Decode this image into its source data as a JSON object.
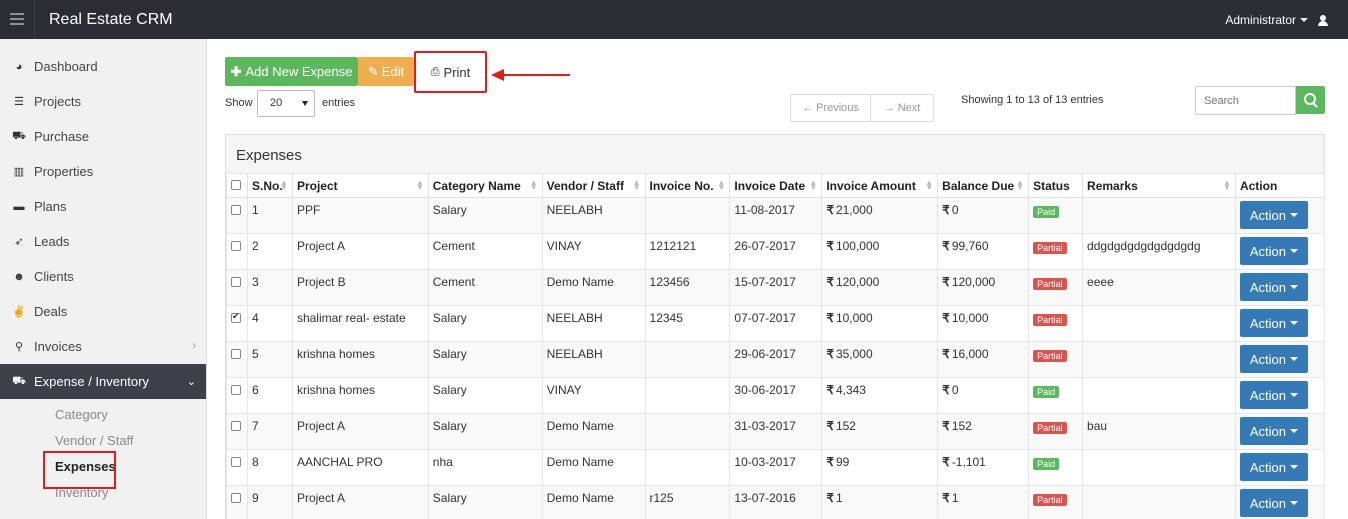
{
  "header": {
    "app_title": "Real Estate CRM",
    "user_label": "Administrator"
  },
  "sidebar": {
    "items": [
      {
        "label": "Dashboard",
        "icon": "dashboard-icon"
      },
      {
        "label": "Projects",
        "icon": "list-icon"
      },
      {
        "label": "Purchase",
        "icon": "cart-icon"
      },
      {
        "label": "Properties",
        "icon": "building-icon"
      },
      {
        "label": "Plans",
        "icon": "briefcase-icon"
      },
      {
        "label": "Leads",
        "icon": "rocket-icon"
      },
      {
        "label": "Clients",
        "icon": "users-icon"
      },
      {
        "label": "Deals",
        "icon": "thumbs-up-icon"
      },
      {
        "label": "Invoices",
        "icon": "pin-icon"
      },
      {
        "label": "Expense / Inventory",
        "icon": "cart-icon"
      }
    ],
    "subitems": [
      "Category",
      "Vendor / Staff",
      "Expenses",
      "Inventory"
    ]
  },
  "toolbar": {
    "add_label": "Add New Expense",
    "edit_label": "Edit",
    "print_label": "Print"
  },
  "list_controls": {
    "show_label": "Show",
    "entries_value": "20",
    "entries_label": "entries",
    "prev_label": "← Previous",
    "next_label": "→ Next",
    "showing_text": "Showing 1 to 13 of 13 entries",
    "search_placeholder": "Search"
  },
  "table": {
    "title": "Expenses",
    "columns": [
      "S.No.",
      "Project",
      "Category Name",
      "Vendor / Staff",
      "Invoice No.",
      "Invoice Date",
      "Invoice Amount",
      "Balance Due",
      "Status",
      "Remarks",
      "Action"
    ],
    "currency_symbol": "₹",
    "action_label": "Action",
    "rows": [
      {
        "checked": false,
        "sno": "1",
        "project": "PPF",
        "category": "Salary",
        "vendor": "NEELABH",
        "invoice_no": "",
        "invoice_date": "11-08-2017",
        "amount": "21,000",
        "balance": "0",
        "status": "Paid",
        "remarks": ""
      },
      {
        "checked": false,
        "sno": "2",
        "project": "Project A",
        "category": "Cement",
        "vendor": "VINAY",
        "invoice_no": "1212121",
        "invoice_date": "26-07-2017",
        "amount": "100,000",
        "balance": "99,760",
        "status": "Partial",
        "remarks": "ddgdgdgdgdgdgdgdg"
      },
      {
        "checked": false,
        "sno": "3",
        "project": "Project B",
        "category": "Cement",
        "vendor": "Demo Name",
        "invoice_no": "123456",
        "invoice_date": "15-07-2017",
        "amount": "120,000",
        "balance": "120,000",
        "status": "Partial",
        "remarks": "eeee"
      },
      {
        "checked": true,
        "sno": "4",
        "project": "shalimar real- estate",
        "category": "Salary",
        "vendor": "NEELABH",
        "invoice_no": "12345",
        "invoice_date": "07-07-2017",
        "amount": "10,000",
        "balance": "10,000",
        "status": "Partial",
        "remarks": ""
      },
      {
        "checked": false,
        "sno": "5",
        "project": "krishna homes",
        "category": "Salary",
        "vendor": "NEELABH",
        "invoice_no": "",
        "invoice_date": "29-06-2017",
        "amount": "35,000",
        "balance": "16,000",
        "status": "Partial",
        "remarks": ""
      },
      {
        "checked": false,
        "sno": "6",
        "project": "krishna homes",
        "category": "Salary",
        "vendor": "VINAY",
        "invoice_no": "",
        "invoice_date": "30-06-2017",
        "amount": "4,343",
        "balance": "0",
        "status": "Paid",
        "remarks": ""
      },
      {
        "checked": false,
        "sno": "7",
        "project": "Project A",
        "category": "Salary",
        "vendor": "Demo Name",
        "invoice_no": "",
        "invoice_date": "31-03-2017",
        "amount": "152",
        "balance": "152",
        "status": "Partial",
        "remarks": "bau"
      },
      {
        "checked": false,
        "sno": "8",
        "project": "AANCHAL PRO",
        "category": "nha",
        "vendor": "Demo Name",
        "invoice_no": "",
        "invoice_date": "10-03-2017",
        "amount": "99",
        "balance": "-1,101",
        "status": "Paid",
        "remarks": ""
      },
      {
        "checked": false,
        "sno": "9",
        "project": "Project A",
        "category": "Salary",
        "vendor": "Demo Name",
        "invoice_no": "r125",
        "invoice_date": "13-07-2016",
        "amount": "1",
        "balance": "1",
        "status": "Partial",
        "remarks": ""
      }
    ]
  },
  "colors": {
    "green": "#5cb85c",
    "orange": "#f0ad4e",
    "blue": "#337ab7",
    "red": "#d9534f",
    "annotation_red": "#e21b1b",
    "topbar": "#2a2d33",
    "sidebar_active": "#3c4048"
  }
}
